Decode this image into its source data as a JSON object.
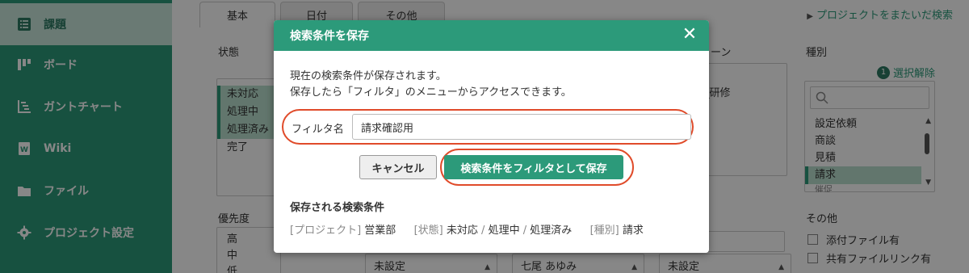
{
  "sidebar": {
    "items": [
      {
        "label": "課題",
        "icon": "list-icon"
      },
      {
        "label": "ボード",
        "icon": "board-icon"
      },
      {
        "label": "ガントチャート",
        "icon": "gantt-icon"
      },
      {
        "label": "Wiki",
        "icon": "wiki-icon"
      },
      {
        "label": "ファイル",
        "icon": "file-icon"
      },
      {
        "label": "プロジェクト設定",
        "icon": "gear-icon"
      }
    ]
  },
  "search": {
    "tabs": [
      "基本",
      "日付",
      "その他"
    ],
    "cross_project_link": "プロジェクトをまたいだ検索",
    "status_label": "状態",
    "status_options": [
      "未対応",
      "処理中",
      "処理済み",
      "完了"
    ],
    "milestone_label_fragment": "ーン",
    "milestone_option_fragment": "_研修",
    "priority_label": "優先度",
    "priority_options": [
      "高",
      "中",
      "低"
    ],
    "unset_1": "未設定",
    "assignee_value": "七尾 あゆみ",
    "unset_2": "未設定",
    "type_label": "種別",
    "clear_count": "1",
    "clear_label": "選択解除",
    "type_options": [
      "設定依頼",
      "商談",
      "見積",
      "請求",
      "催促"
    ],
    "other_label": "その他",
    "attach_label": "添付ファイル有",
    "shared_label": "共有ファイルリンク有"
  },
  "modal": {
    "title": "検索条件を保存",
    "desc_line1": "現在の検索条件が保存されます。",
    "desc_line2": "保存したら「フィルタ」のメニューからアクセスできます。",
    "filter_label": "フィルタ名",
    "filter_value": "請求確認用",
    "cancel_label": "キャンセル",
    "save_label": "検索条件をフィルタとして保存",
    "saved_heading": "保存される検索条件",
    "cond_project_key": "[プロジェクト]",
    "cond_project_val": "営業部",
    "cond_status_key": "[状態]",
    "cond_status_vals": [
      "未対応",
      "処理中",
      "処理済み"
    ],
    "cond_type_key": "[種別]",
    "cond_type_val": "請求"
  },
  "colors": {
    "brand": "#2c9a7a",
    "highlight": "#e04b2a"
  }
}
